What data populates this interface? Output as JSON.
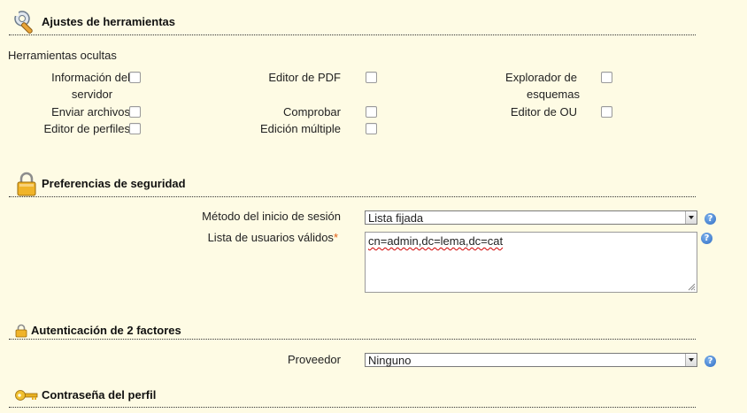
{
  "tools_section": {
    "title": "Ajustes de herramientas",
    "hidden_tools_label": "Herramientas ocultas",
    "tools": [
      {
        "line1": "Información del",
        "line2": "servidor",
        "checked": false
      },
      {
        "line1": "Editor de PDF",
        "line2": "",
        "checked": false
      },
      {
        "line1": "Explorador de",
        "line2": "esquemas",
        "checked": false
      },
      {
        "line1": "Enviar archivos",
        "line2": "",
        "checked": false
      },
      {
        "line1": "Comprobar",
        "line2": "",
        "checked": false
      },
      {
        "line1": "Editor de OU",
        "line2": "",
        "checked": false
      },
      {
        "line1": "Editor de perfiles",
        "line2": "",
        "checked": false
      },
      {
        "line1": "Edición múltiple",
        "line2": "",
        "checked": false
      }
    ]
  },
  "security_section": {
    "title": "Preferencias de seguridad",
    "login_method_label": "Método del inicio de sesión",
    "login_method_value": "Lista fijada",
    "valid_users_label": "Lista de usuarios válidos",
    "required_mark": "*",
    "valid_users_value": "cn=admin,dc=lema,dc=cat"
  },
  "twofactor_section": {
    "title": "Autenticación de 2 factores",
    "provider_label": "Proveedor",
    "provider_value": "Ninguno"
  },
  "password_section": {
    "title": "Contraseña del perfil"
  },
  "help_glyph": "?",
  "icons": [
    "tools-icon",
    "lock-icon",
    "small-lock-icon",
    "key-icon",
    "help-icon"
  ]
}
